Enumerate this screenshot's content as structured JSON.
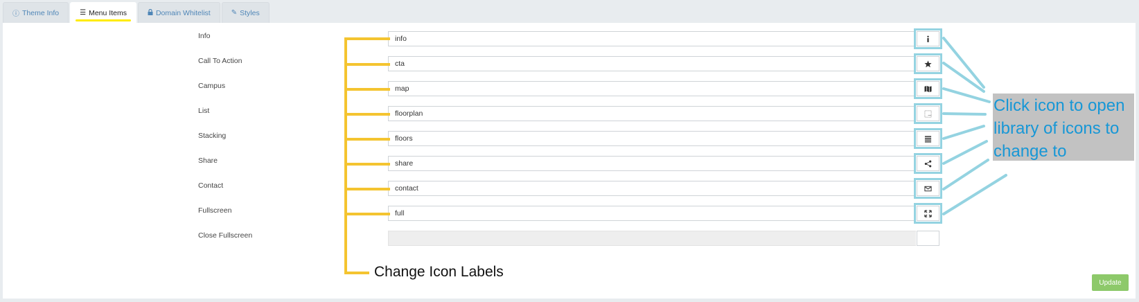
{
  "tabs": [
    {
      "label": "Theme Info",
      "icon": "info-circle-icon",
      "active": false
    },
    {
      "label": "Menu Items",
      "icon": "list-icon",
      "active": true
    },
    {
      "label": "Domain Whitelist",
      "icon": "lock-icon",
      "active": false
    },
    {
      "label": "Styles",
      "icon": "brush-icon",
      "active": false
    }
  ],
  "menu_items": [
    {
      "label": "Info",
      "value": "info",
      "icon": "info-icon"
    },
    {
      "label": "Call To Action",
      "value": "cta",
      "icon": "star-icon"
    },
    {
      "label": "Campus",
      "value": "map",
      "icon": "map-icon"
    },
    {
      "label": "List",
      "value": "floorplan",
      "icon": "floorplan-icon"
    },
    {
      "label": "Stacking",
      "value": "floors",
      "icon": "bars-icon"
    },
    {
      "label": "Share",
      "value": "share",
      "icon": "share-icon"
    },
    {
      "label": "Contact",
      "value": "contact",
      "icon": "envelope-icon"
    },
    {
      "label": "Fullscreen",
      "value": "full",
      "icon": "expand-icon"
    },
    {
      "label": "Close Fullscreen",
      "value": "",
      "icon": ""
    }
  ],
  "annotations": {
    "labels_callout": "Change Icon Labels",
    "icons_callout": "Click icon to open library of icons to change to",
    "yellow_color": "#f4c430",
    "blue_color": "#1797d6",
    "highlight_color": "#94d3e1"
  },
  "update_label": "Update",
  "accent_colors": {
    "tab_link": "#4f86b7",
    "update_button": "#8dc96a",
    "active_underline": "#ffec00"
  }
}
